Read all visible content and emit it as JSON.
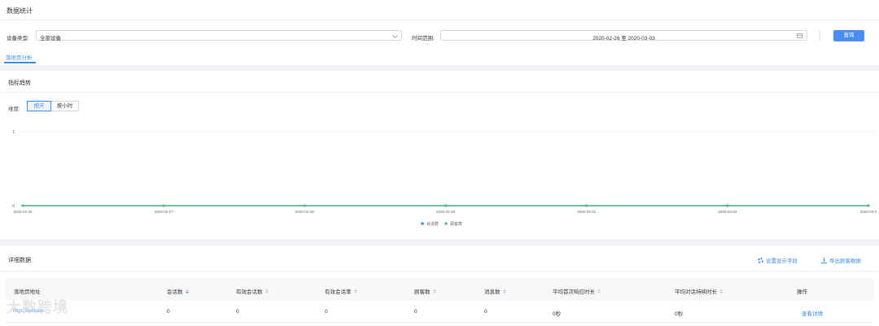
{
  "header": {
    "title": "数据统计"
  },
  "filters": {
    "device_type_label": "设备类型:",
    "device_type_value": "全部设备",
    "time_range_label": "时间范围:",
    "time_range_value": "2020-02-26 至 2020-03-03",
    "query_button": "查询"
  },
  "tabs": [
    {
      "label": "落地页分析",
      "active": true
    }
  ],
  "trend": {
    "title": "指标趋势",
    "granularity_label": "维度:",
    "options": [
      {
        "label": "按天",
        "active": true
      },
      {
        "label": "按小时",
        "active": false
      }
    ]
  },
  "chart_data": {
    "type": "line",
    "x": [
      "2020-02-26",
      "2020-02-27",
      "2020-02-28",
      "2020-02-29",
      "2020-03-01",
      "2020-03-02",
      "2020-03-03"
    ],
    "x_tick_labels": [
      "2020-02-26",
      "2020-02-27",
      "2020-02-28",
      "2020-02-29",
      "2020-03-01",
      "2020-03-02",
      "2020-03-0"
    ],
    "series": [
      {
        "name": "会话数",
        "values": [
          0,
          0,
          0,
          0,
          0,
          0,
          0
        ],
        "color": "#3a8ee6"
      },
      {
        "name": "顾客数",
        "values": [
          0,
          0,
          0,
          0,
          0,
          0,
          0
        ],
        "color": "#5fbf7f"
      }
    ],
    "ylim": [
      0,
      1
    ],
    "yticks": [
      "0",
      "1"
    ],
    "grid": true,
    "legend": "bottom-center"
  },
  "detail": {
    "title": "详细数据",
    "settings_label": "设置显示字段",
    "export_label": "导出顾客数据",
    "columns": [
      "落地页地址",
      "会话数",
      "有效会话数",
      "有效会话率",
      "顾客数",
      "消息数",
      "平均首次响应时长",
      "平均对话持续时长",
      "操作"
    ],
    "rows": [
      {
        "url": "https://webaqr...",
        "sessions": "0",
        "valid_sessions": "0",
        "valid_rate": "0",
        "customers": "0",
        "messages": "0",
        "avg_first_response": "0秒",
        "avg_duration": "0秒",
        "action": "查看详情"
      }
    ]
  },
  "watermark": "大数跨境",
  "colors": {
    "primary": "#4a8ef5",
    "link": "#3a8ee6",
    "line_green": "#5fbf7f"
  }
}
